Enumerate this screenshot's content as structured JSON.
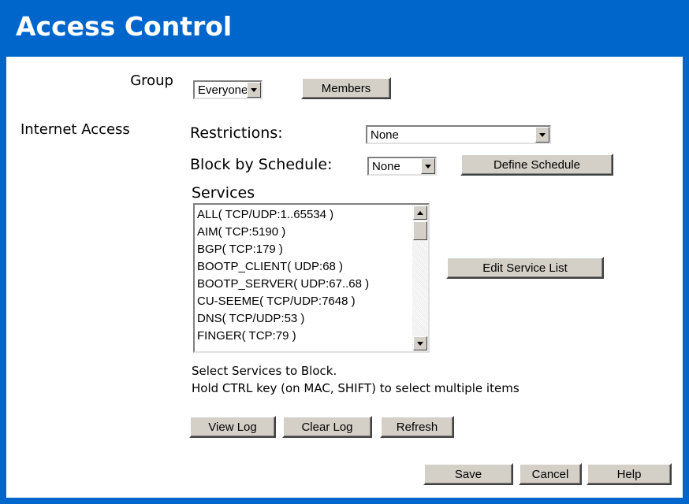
{
  "page": {
    "title": "Access Control"
  },
  "group": {
    "label": "Group",
    "selected": "Everyone",
    "members_button": "Members"
  },
  "internet_access": {
    "label": "Internet Access",
    "restrictions_label": "Restrictions:",
    "restrictions_value": "None",
    "schedule_label": "Block by Schedule:",
    "schedule_value": "None",
    "define_schedule_button": "Define Schedule",
    "services_label": "Services",
    "services": [
      "ALL( TCP/UDP:1..65534 )",
      "AIM( TCP:5190 )",
      "BGP( TCP:179 )",
      "BOOTP_CLIENT( UDP:68 )",
      "BOOTP_SERVER( UDP:67..68 )",
      "CU-SEEME( TCP/UDP:7648 )",
      "DNS( TCP/UDP:53 )",
      "FINGER( TCP:79 )"
    ],
    "edit_service_list_button": "Edit Service List",
    "hint_line1": "Select Services to Block.",
    "hint_line2": "Hold CTRL key (on MAC, SHIFT) to select multiple items"
  },
  "log": {
    "view_log_button": "View Log",
    "clear_log_button": "Clear Log",
    "refresh_button": "Refresh"
  },
  "footer": {
    "save_button": "Save",
    "cancel_button": "Cancel",
    "help_button": "Help"
  },
  "colors": {
    "frame_blue": "#0066cc",
    "button_face": "#d4d0c8"
  }
}
